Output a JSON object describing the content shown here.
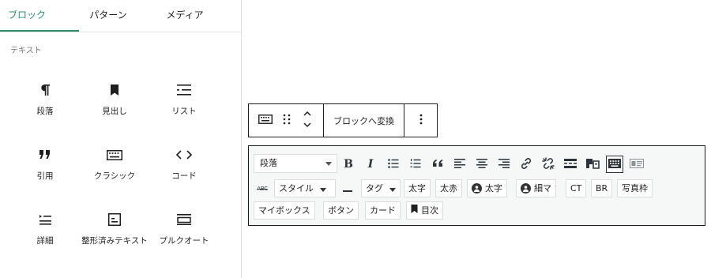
{
  "tabs": [
    {
      "label": "ブロック",
      "active": true
    },
    {
      "label": "パターン",
      "active": false
    },
    {
      "label": "メディア",
      "active": false
    }
  ],
  "category": "テキスト",
  "blocks": [
    {
      "label": "段落",
      "icon": "paragraph-icon"
    },
    {
      "label": "見出し",
      "icon": "bookmark-icon"
    },
    {
      "label": "リスト",
      "icon": "list-icon"
    },
    {
      "label": "引用",
      "icon": "quote-icon"
    },
    {
      "label": "クラシック",
      "icon": "keyboard-icon"
    },
    {
      "label": "コード",
      "icon": "code-icon"
    },
    {
      "label": "詳細",
      "icon": "details-icon"
    },
    {
      "label": "整形済みテキスト",
      "icon": "preformatted-icon"
    },
    {
      "label": "プルクオート",
      "icon": "pullquote-icon"
    }
  ],
  "block_toolbar": {
    "transform_label": "ブロックへ変換",
    "icons": [
      "keyboard-icon",
      "drag-handle-icon",
      "move-up-down-icon",
      "more-options-icon"
    ]
  },
  "classic_toolbar": {
    "format_select": "段落",
    "row1_icons": [
      "bold-icon",
      "italic-icon",
      "bullet-list-icon",
      "numbered-list-icon",
      "blockquote-icon",
      "align-left-icon",
      "align-center-icon",
      "align-right-icon",
      "link-icon",
      "unlink-icon",
      "read-more-icon",
      "paste-text-icon",
      "toolbar-toggle-icon",
      "html-block-icon"
    ],
    "row2": {
      "abc_icon": "strikethrough-icon",
      "style_label": "スタイル",
      "hr_icon": "horizontal-line-icon",
      "tag_label": "タグ",
      "buttons": [
        "太字",
        "太赤",
        "太字",
        "細マ",
        "CT",
        "BR",
        "写真枠"
      ]
    },
    "row3": {
      "buttons": [
        "マイボックス",
        "ボタン",
        "カード",
        "目次"
      ]
    }
  },
  "colors": {
    "accent": "#2f8a6a",
    "border": "#1e1e1e",
    "muted": "#757575"
  }
}
